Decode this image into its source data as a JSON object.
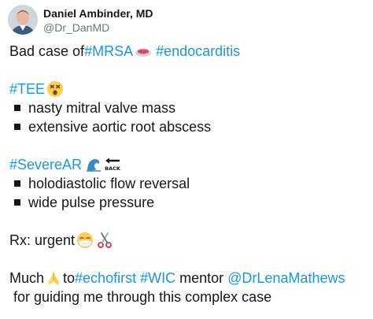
{
  "author": {
    "display_name": "Daniel Ambinder, MD",
    "handle": "@Dr_DanMD"
  },
  "tweet": {
    "line1_prefix": "Bad case of ",
    "line1_tag1": "#MRSA",
    "line1_tag2": "#endocarditis",
    "tee_tag": "#TEE",
    "tee_bullets": [
      "nasty mitral valve mass",
      "extensive aortic root abscess"
    ],
    "ar_tag": "#SevereAR",
    "ar_bullets": [
      "holodiastolic flow reversal",
      "wide pulse pressure"
    ],
    "rx_text": "Rx: urgent",
    "much": "Much",
    "to": "to ",
    "tag_echofirst": "#echofirst",
    "tag_wic": "#WIC",
    "mentor": " mentor ",
    "mention": "@DrLenaMathews",
    "closing": " for guiding me through this complex case"
  },
  "icons": {
    "petri_dish": "petri-dish-emoji",
    "dizzy_face": "dizzy-face-emoji",
    "wave": "water-wave-emoji",
    "back_arrow": "back-arrow-emoji",
    "mask_face": "medical-mask-emoji",
    "scissors": "scissors-emoji",
    "praying_hands": "folded-hands-emoji"
  },
  "colors": {
    "link": "#1b95e0",
    "text": "#14171a",
    "secondary": "#657786"
  }
}
